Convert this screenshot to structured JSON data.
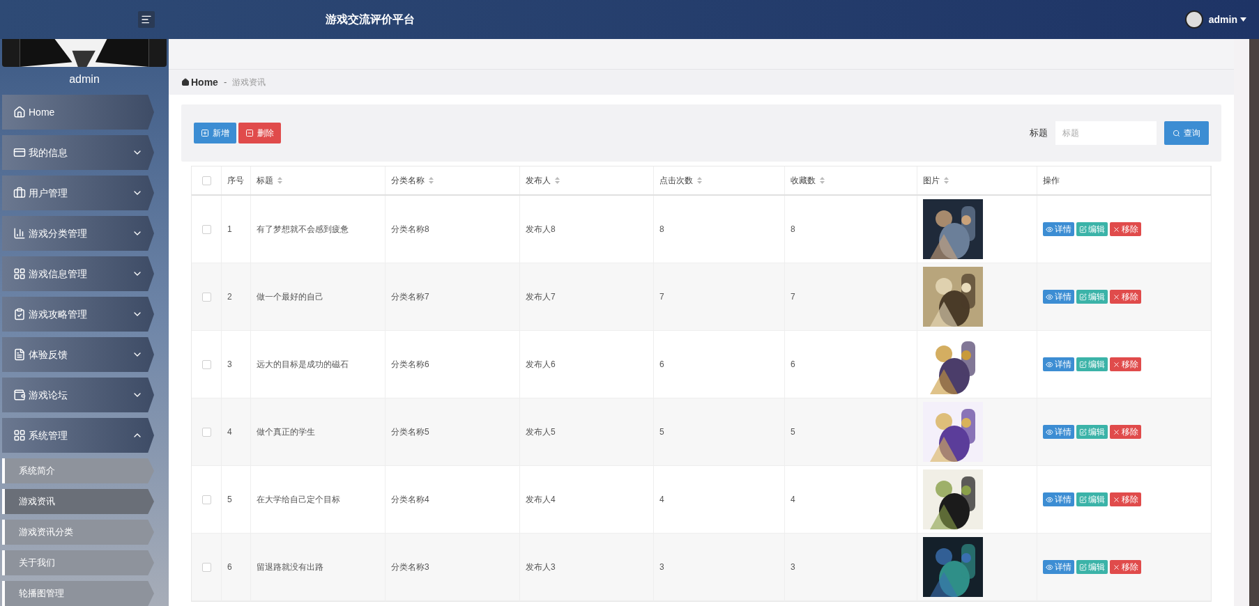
{
  "header": {
    "title": "游戏交流评价平台",
    "user": "admin"
  },
  "sidebar": {
    "user": "admin",
    "items": [
      {
        "label": "Home",
        "expanded": false,
        "has_children": false
      },
      {
        "label": "我的信息",
        "expanded": false,
        "has_children": true
      },
      {
        "label": "用户管理",
        "expanded": false,
        "has_children": true
      },
      {
        "label": "游戏分类管理",
        "expanded": false,
        "has_children": true
      },
      {
        "label": "游戏信息管理",
        "expanded": false,
        "has_children": true
      },
      {
        "label": "游戏攻略管理",
        "expanded": false,
        "has_children": true
      },
      {
        "label": "体验反馈",
        "expanded": false,
        "has_children": true
      },
      {
        "label": "游戏论坛",
        "expanded": false,
        "has_children": true
      },
      {
        "label": "系统管理",
        "expanded": true,
        "has_children": true,
        "children": [
          {
            "label": "系统简介",
            "selected": false
          },
          {
            "label": "游戏资讯",
            "selected": true
          },
          {
            "label": "游戏资讯分类",
            "selected": false
          },
          {
            "label": "关于我们",
            "selected": false
          },
          {
            "label": "轮播图管理",
            "selected": false
          }
        ]
      }
    ]
  },
  "breadcrumb": {
    "home": "Home",
    "separator": "-",
    "current": "游戏资讯"
  },
  "toolbar": {
    "add": "新增",
    "delete": "删除",
    "search_label": "标题",
    "search_placeholder": "标题",
    "search": "查询"
  },
  "table": {
    "columns": [
      {
        "label": "序号",
        "sortable": false
      },
      {
        "label": "标题",
        "sortable": true
      },
      {
        "label": "分类名称",
        "sortable": true
      },
      {
        "label": "发布人",
        "sortable": true
      },
      {
        "label": "点击次数",
        "sortable": true
      },
      {
        "label": "收藏数",
        "sortable": true
      },
      {
        "label": "图片",
        "sortable": true
      },
      {
        "label": "操作",
        "sortable": false
      }
    ],
    "header_checked": false,
    "rows": [
      {
        "checked": false,
        "cells": [
          "1",
          "有了梦想就不会感到疲惫",
          "分类名称8",
          "发布人8",
          "8",
          "8"
        ],
        "actions": [
          "详情",
          "编辑",
          "移除"
        ]
      },
      {
        "checked": false,
        "cells": [
          "2",
          "做一个最好的自己",
          "分类名称7",
          "发布人7",
          "7",
          "7"
        ],
        "actions": [
          "详情",
          "编辑",
          "移除"
        ]
      },
      {
        "checked": false,
        "cells": [
          "3",
          "远大的目标是成功的磁石",
          "分类名称6",
          "发布人6",
          "6",
          "6"
        ],
        "actions": [
          "详情",
          "编辑",
          "移除"
        ]
      },
      {
        "checked": false,
        "cells": [
          "4",
          "做个真正的学生",
          "分类名称5",
          "发布人5",
          "5",
          "5"
        ],
        "actions": [
          "详情",
          "编辑",
          "移除"
        ]
      },
      {
        "checked": false,
        "cells": [
          "5",
          "在大学给自己定个目标",
          "分类名称4",
          "发布人4",
          "4",
          "4"
        ],
        "actions": [
          "详情",
          "编辑",
          "移除"
        ]
      },
      {
        "checked": false,
        "cells": [
          "6",
          "留退路就没有出路",
          "分类名称3",
          "发布人3",
          "3",
          "3"
        ],
        "actions": [
          "详情",
          "编辑",
          "移除"
        ]
      }
    ]
  }
}
